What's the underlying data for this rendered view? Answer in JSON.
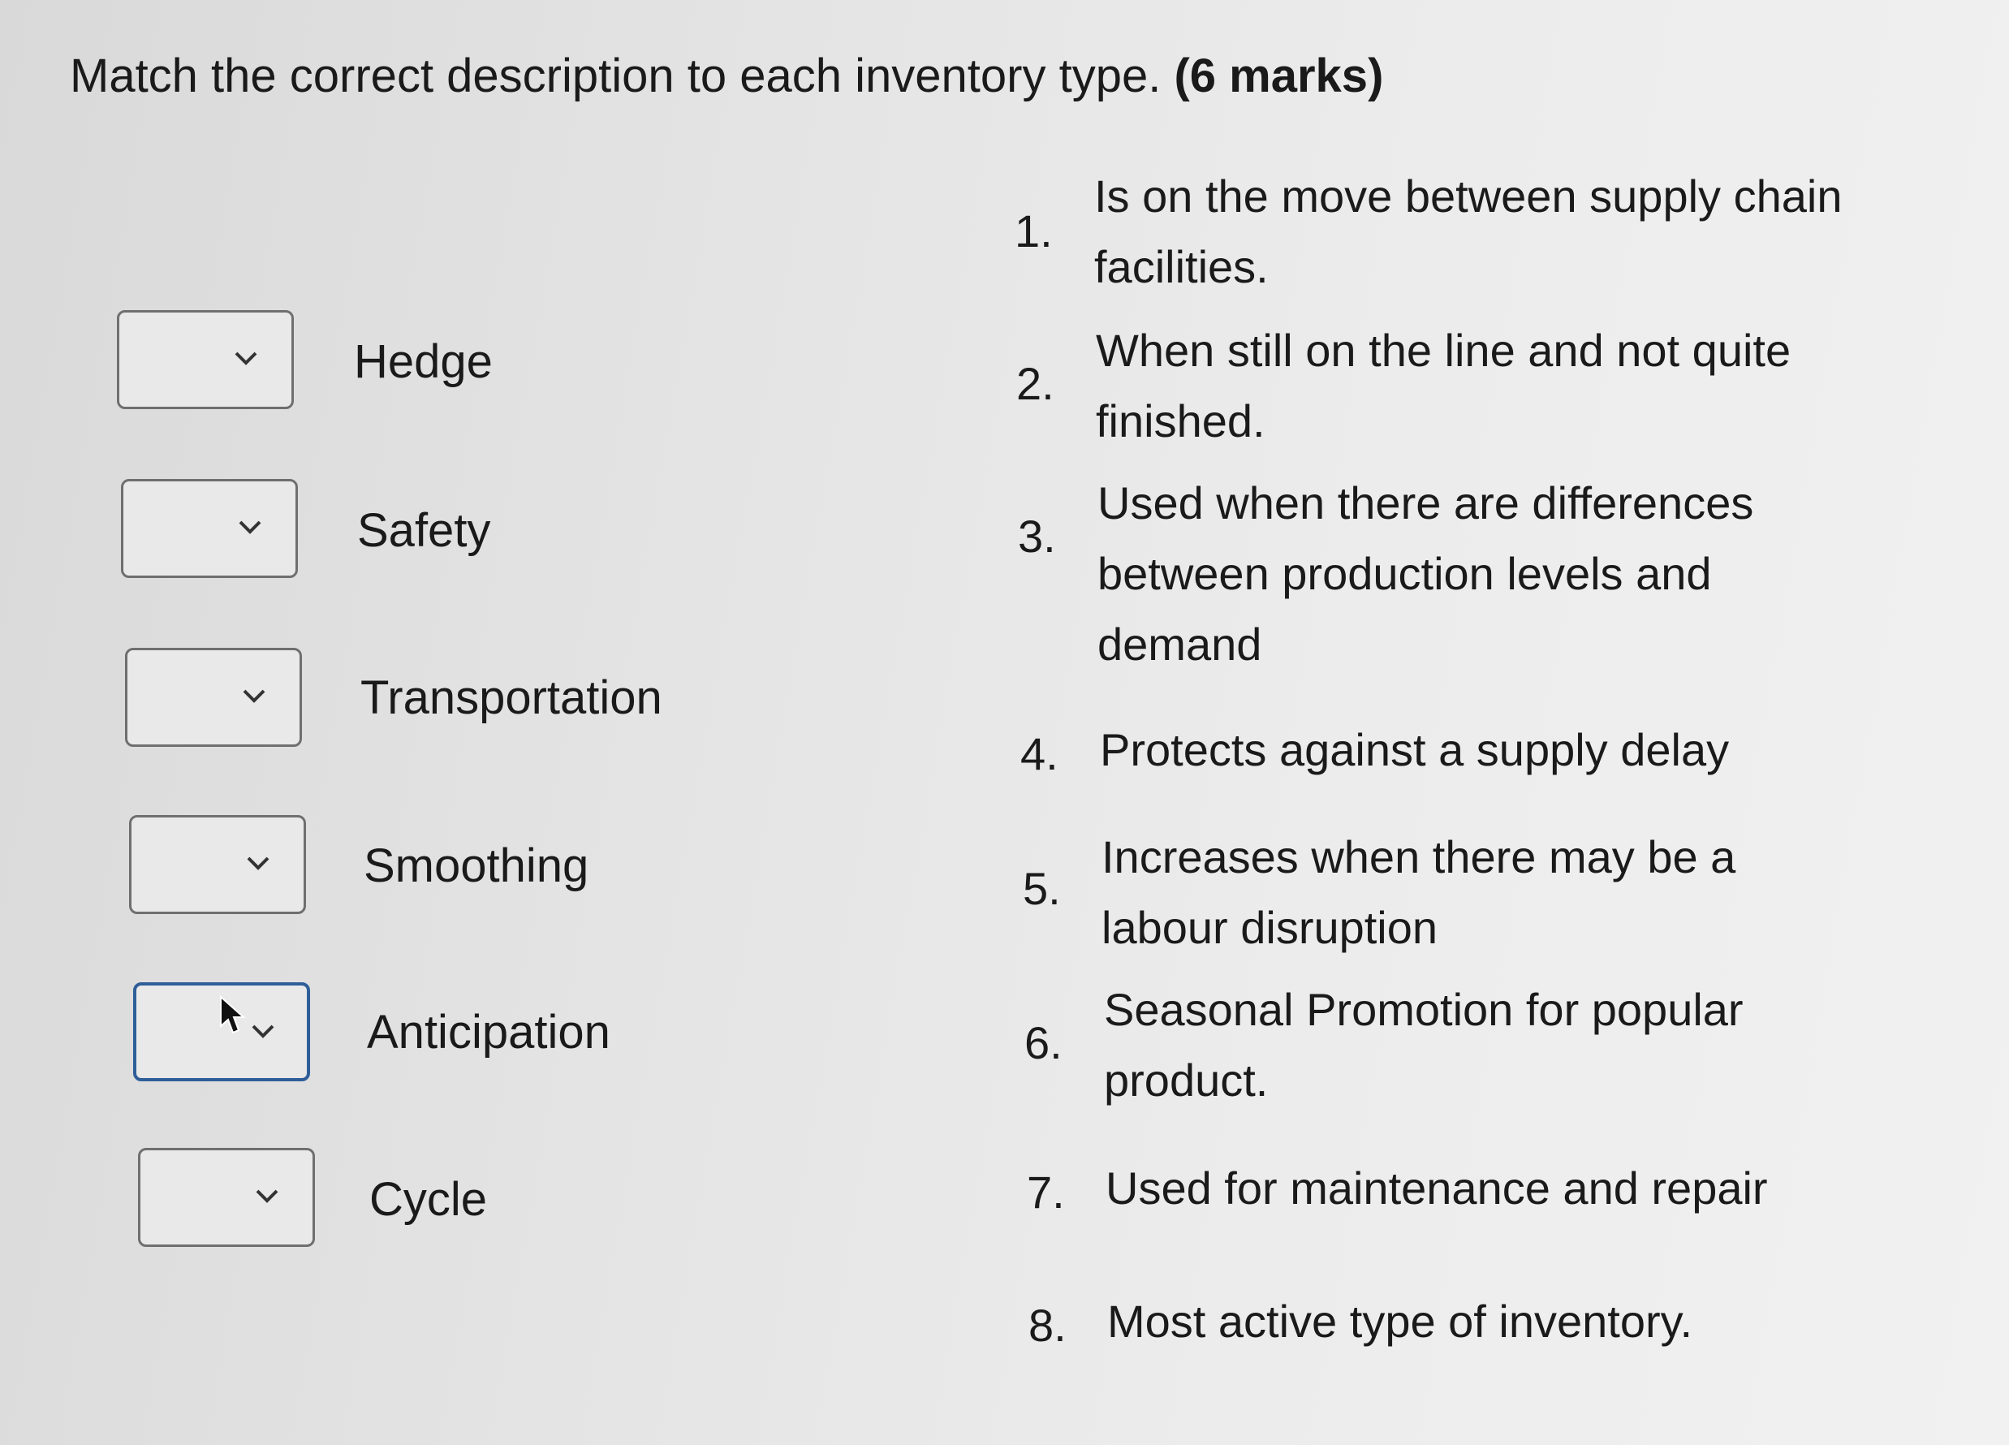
{
  "question": {
    "title": "Match the correct description to each inventory type.",
    "marks": "(6 marks)"
  },
  "matching_items": [
    {
      "term": "Hedge",
      "selected": ""
    },
    {
      "term": "Safety",
      "selected": ""
    },
    {
      "term": "Transportation",
      "selected": ""
    },
    {
      "term": "Smoothing",
      "selected": ""
    },
    {
      "term": "Anticipation",
      "selected": "",
      "focused": true
    },
    {
      "term": "Cycle",
      "selected": ""
    }
  ],
  "descriptions": [
    {
      "number": "1.",
      "text": "Is on the move between supply chain facilities."
    },
    {
      "number": "2.",
      "text": "When still on the line and not quite finished."
    },
    {
      "number": "3.",
      "text": "Used when there are differences between production levels and demand"
    },
    {
      "number": "4.",
      "text": "Protects against a supply delay"
    },
    {
      "number": "5.",
      "text": "Increases when there may be a labour disruption"
    },
    {
      "number": "6.",
      "text": "Seasonal Promotion for popular product."
    },
    {
      "number": "7.",
      "text": "Used for maintenance and repair"
    },
    {
      "number": "8.",
      "text": "Most active type of inventory."
    }
  ],
  "icons": {
    "dropdown_arrow": "chevron-down-icon",
    "pointer": "mouse-cursor-icon"
  },
  "colors": {
    "focus_border": "#2f5e99",
    "default_border": "#6f6f6f"
  }
}
